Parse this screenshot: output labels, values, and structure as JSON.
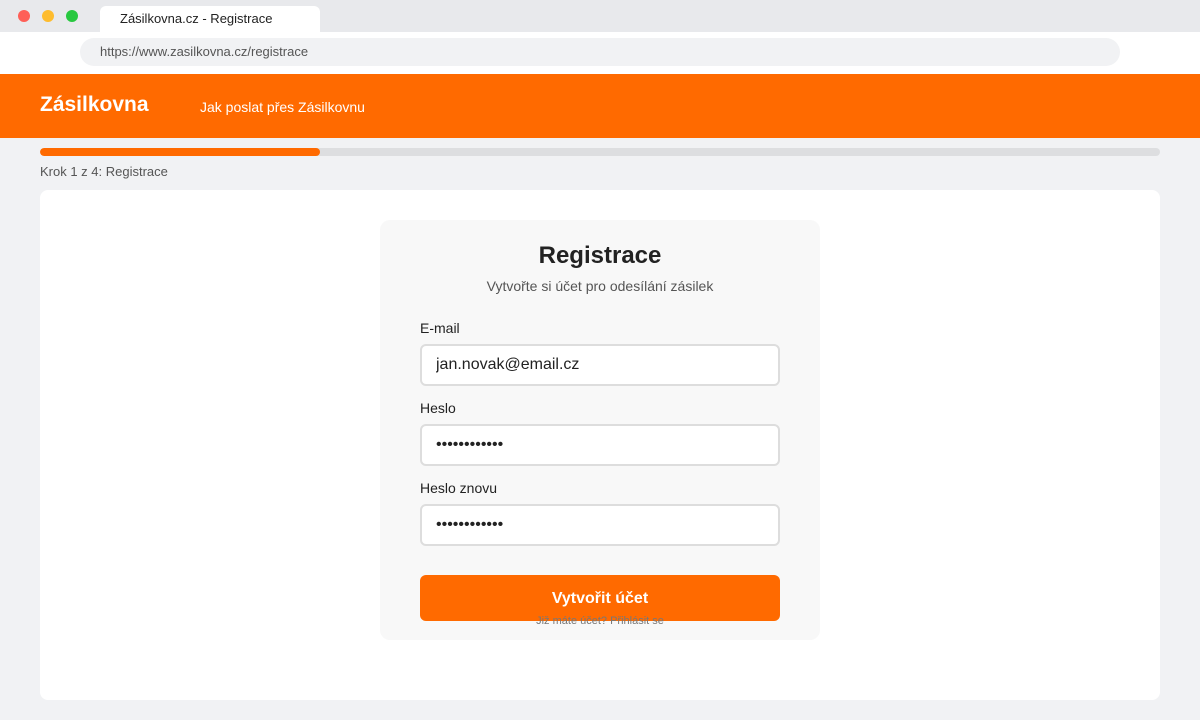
{
  "browser": {
    "tab_title": "Zásilkovna.cz - Registrace",
    "url": "https://www.zasilkovna.cz/registrace"
  },
  "header": {
    "logo": "Zásilkovna",
    "nav_link": "Jak poslat přes Zásilkovnu",
    "accent_color": "#ff6a00"
  },
  "progress": {
    "label": "Krok 1 z 4: Registrace",
    "fraction": 0.25
  },
  "form": {
    "title": "Registrace",
    "subtitle": "Vytvořte si účet pro odesílání zásilek",
    "email_label": "E-mail",
    "email_value": "jan.novak@email.cz",
    "password_label": "Heslo",
    "password_value": "••••••••••••",
    "password_confirm_label": "Heslo znovu",
    "password_confirm_value": "••••••••••••",
    "submit_label": "Vytvořit účet",
    "login_question": "Již máte účet?",
    "login_link": "Přihlásit se"
  }
}
